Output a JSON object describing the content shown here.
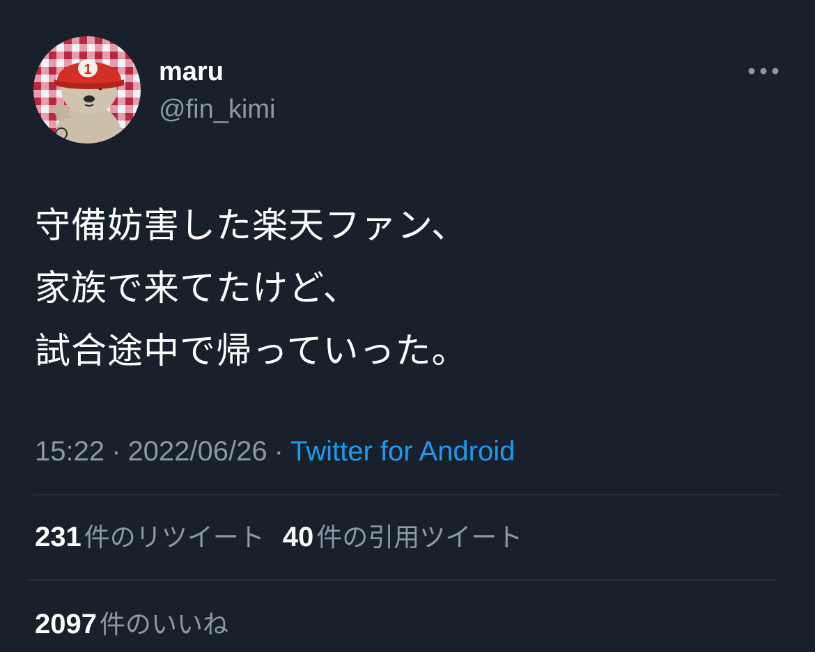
{
  "user": {
    "display_name": "maru",
    "handle": "@fin_kimi",
    "avatar_icon": "bear-with-red-helmet-avatar"
  },
  "tweet": {
    "lines": [
      "守備妨害した楽天ファン、",
      "家族で来てたけど、",
      "試合途中で帰っていった。"
    ],
    "time": "15:22",
    "separator": "·",
    "date": "2022/06/26",
    "source": "Twitter for Android"
  },
  "stats": {
    "retweets": {
      "count": "231",
      "label": "件のリツイート"
    },
    "quotes": {
      "count": "40",
      "label": "件の引用ツイート"
    },
    "likes": {
      "count": "2097",
      "label": "件のいいね"
    }
  },
  "colors": {
    "background": "#17202b",
    "secondary_text": "#8b98a5",
    "link": "#1d9bf0",
    "divider": "#38444d"
  },
  "icons": {
    "more": "more-horizontal-icon"
  }
}
